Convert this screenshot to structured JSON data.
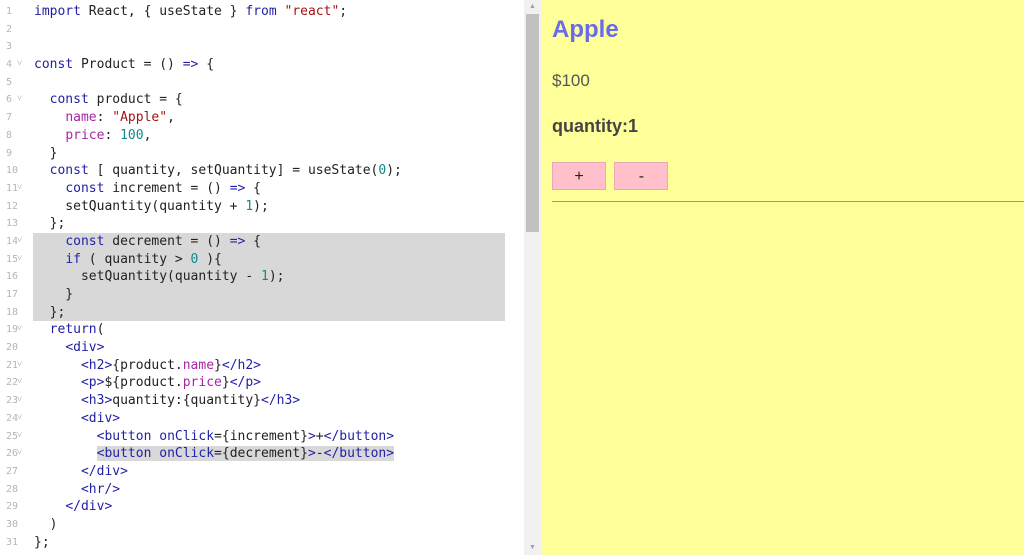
{
  "editor": {
    "lines": [
      {
        "n": "1",
        "fold": false,
        "sel": false,
        "parts": [
          [
            "kw",
            "import"
          ],
          [
            "def",
            " React, { useState } "
          ],
          [
            "kw",
            "from"
          ],
          [
            "def",
            " "
          ],
          [
            "str",
            "\"react\""
          ],
          [
            "def",
            ";"
          ]
        ]
      },
      {
        "n": "2",
        "fold": false,
        "sel": false,
        "parts": []
      },
      {
        "n": "3",
        "fold": false,
        "sel": false,
        "parts": []
      },
      {
        "n": "4",
        "fold": true,
        "sel": false,
        "parts": [
          [
            "kw",
            "const"
          ],
          [
            "def",
            " Product = () "
          ],
          [
            "kw",
            "=>"
          ],
          [
            "def",
            " {"
          ]
        ]
      },
      {
        "n": "5",
        "fold": false,
        "sel": false,
        "parts": []
      },
      {
        "n": "6",
        "fold": true,
        "sel": false,
        "parts": [
          [
            "def",
            "  "
          ],
          [
            "kw",
            "const"
          ],
          [
            "def",
            " product = {"
          ]
        ]
      },
      {
        "n": "7",
        "fold": false,
        "sel": false,
        "parts": [
          [
            "def",
            "    "
          ],
          [
            "prop",
            "name"
          ],
          [
            "def",
            ": "
          ],
          [
            "str",
            "\"Apple\""
          ],
          [
            "def",
            ","
          ]
        ]
      },
      {
        "n": "8",
        "fold": false,
        "sel": false,
        "parts": [
          [
            "def",
            "    "
          ],
          [
            "prop",
            "price"
          ],
          [
            "def",
            ": "
          ],
          [
            "num",
            "100"
          ],
          [
            "def",
            ","
          ]
        ]
      },
      {
        "n": "9",
        "fold": false,
        "sel": false,
        "parts": [
          [
            "def",
            "  }"
          ]
        ]
      },
      {
        "n": "10",
        "fold": false,
        "sel": false,
        "parts": [
          [
            "def",
            "  "
          ],
          [
            "kw",
            "const"
          ],
          [
            "def",
            " [ quantity, setQuantity] = useState("
          ],
          [
            "num",
            "0"
          ],
          [
            "def",
            ");"
          ]
        ]
      },
      {
        "n": "11",
        "fold": true,
        "sel": false,
        "parts": [
          [
            "def",
            "    "
          ],
          [
            "kw",
            "const"
          ],
          [
            "def",
            " increment = () "
          ],
          [
            "kw",
            "=>"
          ],
          [
            "def",
            " {"
          ]
        ]
      },
      {
        "n": "12",
        "fold": false,
        "sel": false,
        "parts": [
          [
            "def",
            "    setQuantity(quantity + "
          ],
          [
            "num",
            "1"
          ],
          [
            "def",
            ");"
          ]
        ]
      },
      {
        "n": "13",
        "fold": false,
        "sel": false,
        "parts": [
          [
            "def",
            "  };"
          ]
        ]
      },
      {
        "n": "14",
        "fold": true,
        "sel": true,
        "parts": [
          [
            "def",
            "    "
          ],
          [
            "kw",
            "const"
          ],
          [
            "def",
            " decrement = () "
          ],
          [
            "kw",
            "=>"
          ],
          [
            "def",
            " {"
          ]
        ]
      },
      {
        "n": "15",
        "fold": true,
        "sel": true,
        "parts": [
          [
            "def",
            "    "
          ],
          [
            "kw",
            "if"
          ],
          [
            "def",
            " ( quantity > "
          ],
          [
            "num",
            "0"
          ],
          [
            "def",
            " ){"
          ]
        ]
      },
      {
        "n": "16",
        "fold": false,
        "sel": true,
        "parts": [
          [
            "def",
            "      setQuantity(quantity - "
          ],
          [
            "num",
            "1"
          ],
          [
            "def",
            ");"
          ]
        ]
      },
      {
        "n": "17",
        "fold": false,
        "sel": true,
        "parts": [
          [
            "def",
            "    }"
          ]
        ]
      },
      {
        "n": "18",
        "fold": false,
        "sel": true,
        "parts": [
          [
            "def",
            "  };"
          ]
        ]
      },
      {
        "n": "19",
        "fold": true,
        "sel": false,
        "parts": [
          [
            "def",
            "  "
          ],
          [
            "kw",
            "return"
          ],
          [
            "def",
            "("
          ]
        ]
      },
      {
        "n": "20",
        "fold": false,
        "sel": false,
        "parts": [
          [
            "def",
            "    "
          ],
          [
            "tag",
            "<div>"
          ]
        ]
      },
      {
        "n": "21",
        "fold": true,
        "sel": false,
        "parts": [
          [
            "def",
            "      "
          ],
          [
            "tag",
            "<h2>"
          ],
          [
            "def",
            "{product."
          ],
          [
            "prop",
            "name"
          ],
          [
            "def",
            "}"
          ],
          [
            "tag",
            "</h2>"
          ]
        ]
      },
      {
        "n": "22",
        "fold": true,
        "sel": false,
        "parts": [
          [
            "def",
            "      "
          ],
          [
            "tag",
            "<p>"
          ],
          [
            "def",
            "${product."
          ],
          [
            "prop",
            "price"
          ],
          [
            "def",
            "}"
          ],
          [
            "tag",
            "</p>"
          ]
        ]
      },
      {
        "n": "23",
        "fold": true,
        "sel": false,
        "parts": [
          [
            "def",
            "      "
          ],
          [
            "tag",
            "<h3>"
          ],
          [
            "def",
            "quantity:{quantity}"
          ],
          [
            "tag",
            "</h3>"
          ]
        ]
      },
      {
        "n": "24",
        "fold": true,
        "sel": false,
        "parts": [
          [
            "def",
            "      "
          ],
          [
            "tag",
            "<div>"
          ]
        ]
      },
      {
        "n": "25",
        "fold": true,
        "sel": false,
        "parts": [
          [
            "def",
            "        "
          ],
          [
            "tag",
            "<button"
          ],
          [
            "def",
            " "
          ],
          [
            "attr",
            "onClick"
          ],
          [
            "def",
            "={increment}"
          ],
          [
            "tag",
            ">"
          ],
          [
            "def",
            "+"
          ],
          [
            "tag",
            "</button>"
          ]
        ]
      },
      {
        "n": "26",
        "fold": true,
        "sel": false,
        "inline_sel": true,
        "parts": [
          [
            "def",
            "        "
          ],
          [
            "tag",
            "<button"
          ],
          [
            "def",
            " "
          ],
          [
            "attr",
            "onClick"
          ],
          [
            "def",
            "={decrement}"
          ],
          [
            "tag",
            ">"
          ],
          [
            "def",
            "-"
          ],
          [
            "tag",
            "</button>"
          ]
        ]
      },
      {
        "n": "27",
        "fold": false,
        "sel": false,
        "parts": [
          [
            "def",
            "      "
          ],
          [
            "tag",
            "</div>"
          ]
        ]
      },
      {
        "n": "28",
        "fold": false,
        "sel": false,
        "parts": [
          [
            "def",
            "      "
          ],
          [
            "tag",
            "<hr/>"
          ]
        ]
      },
      {
        "n": "29",
        "fold": false,
        "sel": false,
        "parts": [
          [
            "def",
            "    "
          ],
          [
            "tag",
            "</div>"
          ]
        ]
      },
      {
        "n": "30",
        "fold": false,
        "sel": false,
        "parts": [
          [
            "def",
            "  )"
          ]
        ]
      },
      {
        "n": "31",
        "fold": false,
        "sel": false,
        "parts": [
          [
            "def",
            "};"
          ]
        ]
      }
    ]
  },
  "scrollbar": {
    "up_icon": "triangle-up-icon",
    "down_icon": "triangle-down-icon"
  },
  "preview": {
    "title": "Apple",
    "price": "$100",
    "quantity": "quantity:1",
    "increment_label": "+",
    "decrement_label": "-",
    "background": "#ffff99",
    "title_color": "#6a6aec",
    "button_color": "#ffc0cb"
  }
}
